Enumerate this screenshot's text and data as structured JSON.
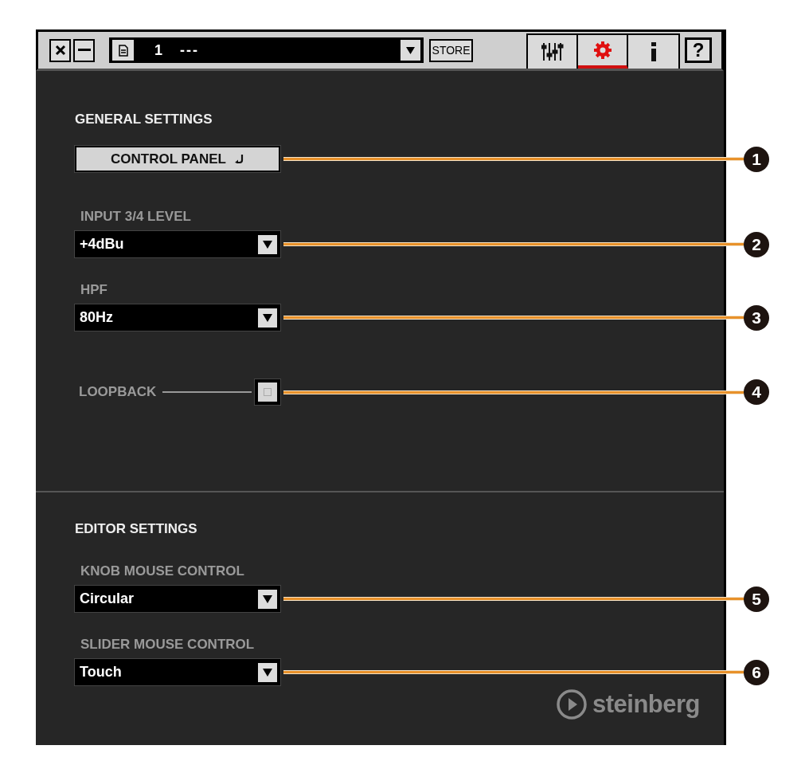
{
  "toolbar": {
    "program_number": "1",
    "program_name": "---",
    "store_label": "STORE",
    "help_label": "?",
    "tabs": [
      {
        "kind": "mixer",
        "selected": false
      },
      {
        "kind": "gear",
        "selected": true
      },
      {
        "kind": "info",
        "selected": false
      }
    ]
  },
  "general_settings": {
    "title": "GENERAL SETTINGS",
    "items": [
      {
        "kind": "button",
        "label": "CONTROL PANEL",
        "callout": "1"
      },
      {
        "kind": "dropdown",
        "label": "INPUT 3/4 LEVEL",
        "value": "+4dBu",
        "callout": "2"
      },
      {
        "kind": "dropdown",
        "label": "HPF",
        "value": "80Hz",
        "callout": "3"
      },
      {
        "kind": "checkbox",
        "label": "LOOPBACK",
        "checked": false,
        "callout": "4"
      }
    ]
  },
  "editor_settings": {
    "title": "EDITOR SETTINGS",
    "items": [
      {
        "kind": "dropdown",
        "label": "KNOB MOUSE CONTROL",
        "value": "Circular",
        "callout": "5"
      },
      {
        "kind": "dropdown",
        "label": "SLIDER MOUSE CONTROL",
        "value": "Touch",
        "callout": "6"
      }
    ]
  },
  "logo": {
    "text": "steinberg"
  }
}
